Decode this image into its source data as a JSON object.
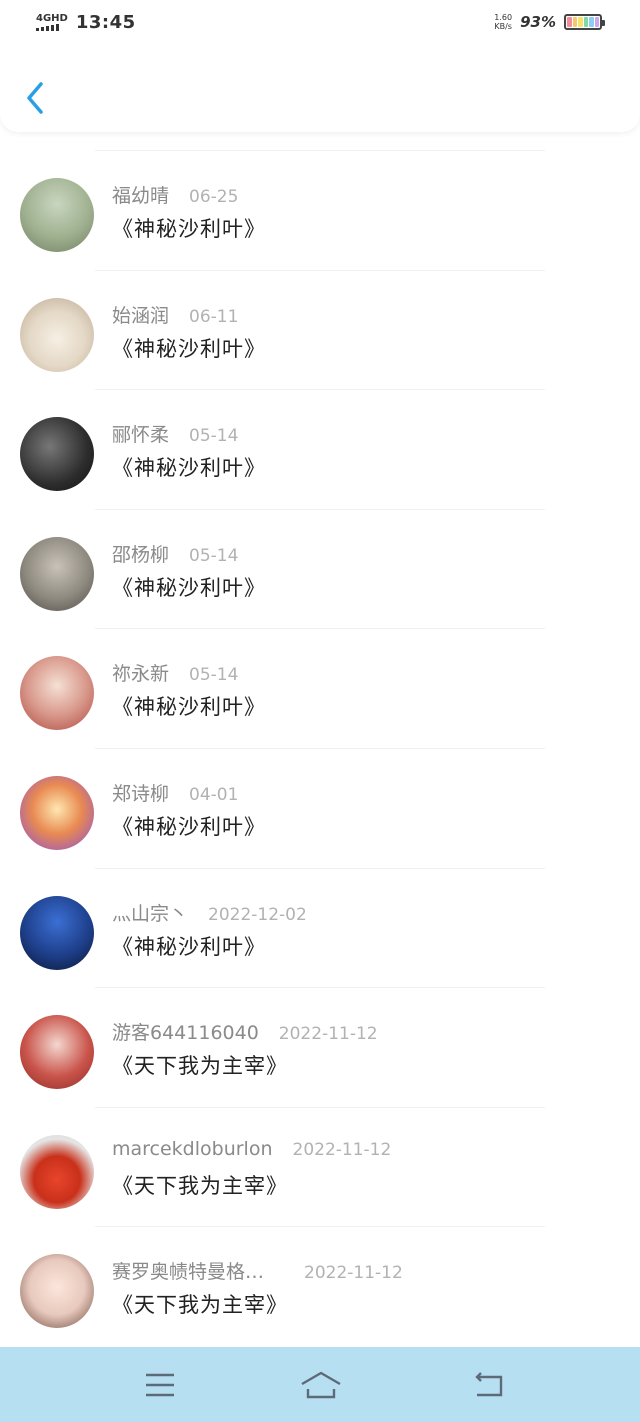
{
  "status_bar": {
    "network": "4GHD",
    "time": "13:45",
    "speed_value": "1.60",
    "speed_unit": "KB/s",
    "battery_percent": "93%"
  },
  "header": {
    "back_icon": "chevron-left-icon",
    "accent_color": "#2a9fe6"
  },
  "messages": [
    {
      "name": "福幼晴",
      "date": "06-25",
      "title": "《神秘沙利叶》"
    },
    {
      "name": "始涵润",
      "date": "06-11",
      "title": "《神秘沙利叶》"
    },
    {
      "name": "郦怀柔",
      "date": "05-14",
      "title": "《神秘沙利叶》"
    },
    {
      "name": "邵杨柳",
      "date": "05-14",
      "title": "《神秘沙利叶》"
    },
    {
      "name": "祢永新",
      "date": "05-14",
      "title": "《神秘沙利叶》"
    },
    {
      "name": "郑诗柳",
      "date": "04-01",
      "title": "《神秘沙利叶》"
    },
    {
      "name": "灬山宗丶",
      "date": "2022-12-02",
      "title": "《神秘沙利叶》"
    },
    {
      "name": "游客644116040",
      "date": "2022-11-12",
      "title": "《天下我为主宰》"
    },
    {
      "name": "marcekdloburlon",
      "date": "2022-11-12",
      "title": "《天下我为主宰》"
    },
    {
      "name": "赛罗奥帻特曼格…",
      "date": "2022-11-12",
      "title": "《天下我为主宰》"
    }
  ],
  "nav_bar": {
    "background": "#b7dff2",
    "icons": [
      "menu-icon",
      "home-icon",
      "back-icon"
    ]
  }
}
